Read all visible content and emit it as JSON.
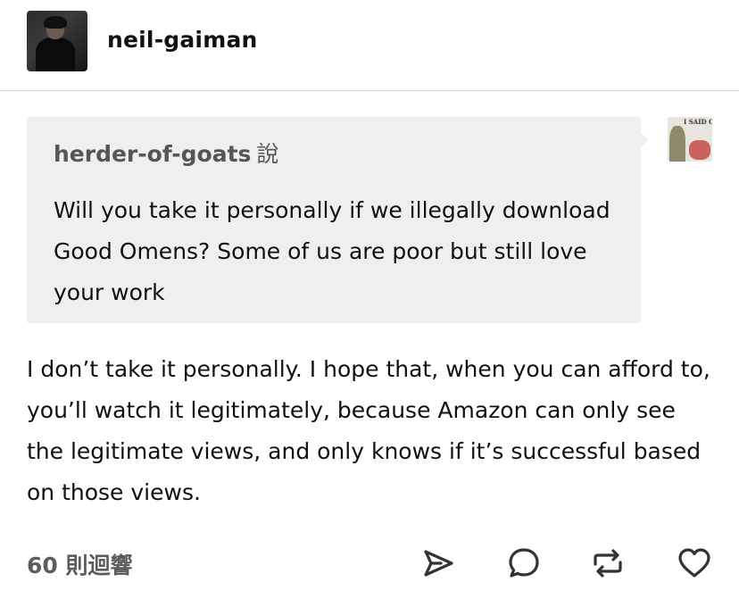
{
  "header": {
    "username": "neil-gaiman",
    "avatar_icon": "author-portrait"
  },
  "ask": {
    "asker": "herder-of-goats",
    "said_label": "說",
    "question": "Will you take it personally if we illegally download Good Omens? Some of us are poor but still love your work",
    "asker_avatar_caption": "I SAID CE"
  },
  "answer": {
    "text": "I don’t take it personally. I hope that, when you can afford to, you’ll watch it legitimately, because Amazon can only see the legitimate views, and only knows if it’s successful based on those views."
  },
  "footer": {
    "notes": "60 則迴響",
    "actions": [
      {
        "name": "share",
        "icon": "send-icon"
      },
      {
        "name": "reply",
        "icon": "speech-bubble-icon"
      },
      {
        "name": "reblog",
        "icon": "reblog-icon"
      },
      {
        "name": "like",
        "icon": "heart-icon"
      }
    ]
  },
  "colors": {
    "ask_background": "#efefef",
    "muted_text": "#565656",
    "divider": "#d9d9d9",
    "icon_color": "#333333"
  }
}
